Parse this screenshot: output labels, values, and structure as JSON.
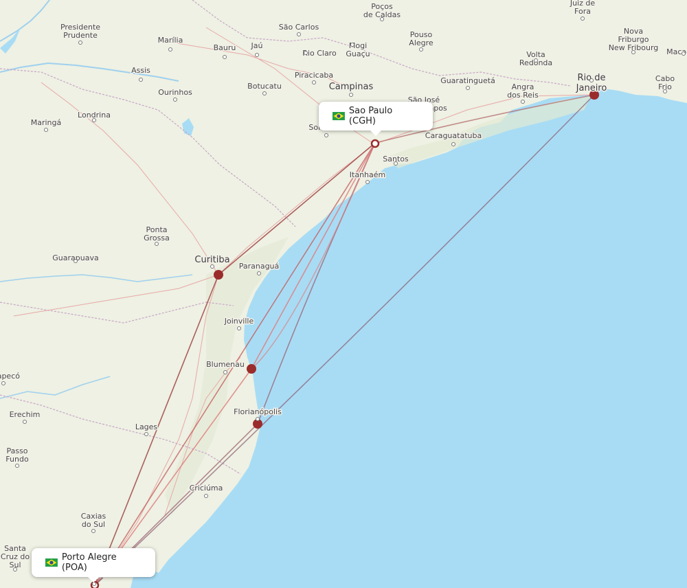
{
  "map": {
    "origin": {
      "name": "Sao Paulo (CGH)",
      "flag": "Brazil"
    },
    "destination": {
      "name": "Porto Alegre (POA)",
      "flag": "Brazil"
    },
    "colors": {
      "ocean": "#a8dcf5",
      "land": "#eef1e3",
      "route_dark": "#9b3b3b",
      "route_light": "#e07a7a",
      "stop": "#9b2c2c"
    },
    "cities": [
      {
        "id": "pocos",
        "lines": [
          "Poços",
          "de Caldas"
        ]
      },
      {
        "id": "juiz",
        "lines": [
          "Juiz de",
          "Fora"
        ]
      },
      {
        "id": "presprud",
        "lines": [
          "Presidente",
          "Prudente"
        ]
      },
      {
        "id": "saocarlos",
        "lines": [
          "São Carlos"
        ]
      },
      {
        "id": "pouso",
        "lines": [
          "Pouso",
          "Alegre"
        ]
      },
      {
        "id": "novafriburgo",
        "lines": [
          "Nova",
          "Friburgo",
          "New Fribourg"
        ]
      },
      {
        "id": "marilia",
        "lines": [
          "Marília"
        ]
      },
      {
        "id": "bauru",
        "lines": [
          "Bauru"
        ]
      },
      {
        "id": "jau",
        "lines": [
          "Jaú"
        ]
      },
      {
        "id": "rioclaro",
        "lines": [
          "Rio Claro"
        ]
      },
      {
        "id": "mogi",
        "lines": [
          "Mogi",
          "Guaçu"
        ]
      },
      {
        "id": "volta",
        "lines": [
          "Volta",
          "Redonda"
        ]
      },
      {
        "id": "macae",
        "lines": [
          "Macaé"
        ]
      },
      {
        "id": "assis",
        "lines": [
          "Assis"
        ]
      },
      {
        "id": "piracicaba",
        "lines": [
          "Piracicaba"
        ]
      },
      {
        "id": "rio",
        "lines": [
          "Rio de",
          "Janeiro"
        ]
      },
      {
        "id": "guaratingueta",
        "lines": [
          "Guaratinguetá"
        ]
      },
      {
        "id": "campinas",
        "lines": [
          "Campinas"
        ]
      },
      {
        "id": "cabofrio",
        "lines": [
          "Cabo",
          "Frio"
        ]
      },
      {
        "id": "botucatu",
        "lines": [
          "Botucatu"
        ]
      },
      {
        "id": "angra",
        "lines": [
          "Angra",
          "dos Reis"
        ]
      },
      {
        "id": "ourinhos",
        "lines": [
          "Ourinhos"
        ]
      },
      {
        "id": "saojose",
        "lines": [
          "São José",
          "dos Campos"
        ]
      },
      {
        "id": "londrina",
        "lines": [
          "Londrina"
        ]
      },
      {
        "id": "maringa",
        "lines": [
          "Maringá"
        ]
      },
      {
        "id": "sorocaba",
        "lines": [
          "Sorocaba"
        ]
      },
      {
        "id": "caraguatatuba",
        "lines": [
          "Caraguatatuba"
        ]
      },
      {
        "id": "santos",
        "lines": [
          "Santos"
        ]
      },
      {
        "id": "itanhaem",
        "lines": [
          "Itanhaém"
        ]
      },
      {
        "id": "pontagrossa",
        "lines": [
          "Ponta",
          "Grossa"
        ]
      },
      {
        "id": "guarapuava",
        "lines": [
          "Guarapuava"
        ]
      },
      {
        "id": "curitiba",
        "lines": [
          "Curitiba"
        ]
      },
      {
        "id": "paranagua",
        "lines": [
          "Paranaguá"
        ]
      },
      {
        "id": "joinville",
        "lines": [
          "Joinville"
        ]
      },
      {
        "id": "blumenau",
        "lines": [
          "Blumenau"
        ]
      },
      {
        "id": "chapeco",
        "lines": [
          "Chapecó"
        ]
      },
      {
        "id": "florianopolis",
        "lines": [
          "Florianópolis"
        ]
      },
      {
        "id": "erechim",
        "lines": [
          "Erechim"
        ]
      },
      {
        "id": "lages",
        "lines": [
          "Lages"
        ]
      },
      {
        "id": "passofundo",
        "lines": [
          "Passo",
          "Fundo"
        ]
      },
      {
        "id": "criciuma",
        "lines": [
          "Criciúma"
        ]
      },
      {
        "id": "caxias",
        "lines": [
          "Caxias",
          "do Sul"
        ]
      },
      {
        "id": "santacruz",
        "lines": [
          "Santa",
          "Cruz do",
          "Sul"
        ]
      },
      {
        "id": "portoalegre",
        "lines": [
          "Porto",
          "Alegre"
        ]
      }
    ]
  }
}
